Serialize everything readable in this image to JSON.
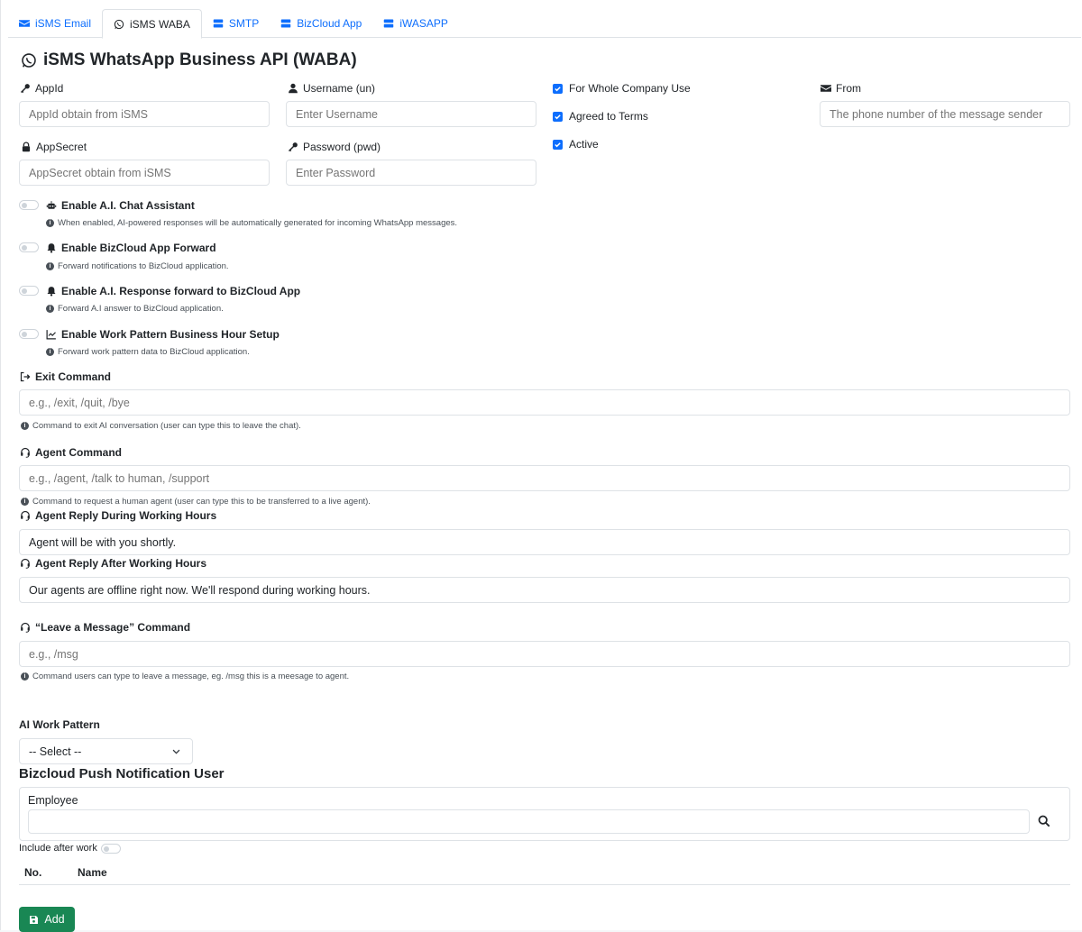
{
  "tabs": [
    {
      "label": "iSMS Email",
      "icon": "envelope-icon",
      "active": false
    },
    {
      "label": "iSMS WABA",
      "icon": "whatsapp-icon",
      "active": true
    },
    {
      "label": "SMTP",
      "icon": "server-icon",
      "active": false
    },
    {
      "label": "BizCloud App",
      "icon": "server-icon",
      "active": false
    },
    {
      "label": "iWASAPP",
      "icon": "server-icon",
      "active": false
    }
  ],
  "title": "iSMS WhatsApp Business API (WABA)",
  "fields": {
    "appid": {
      "label": "AppId",
      "placeholder": "AppId obtain from iSMS"
    },
    "username": {
      "label": "Username (un)",
      "placeholder": "Enter Username"
    },
    "appsecret": {
      "label": "AppSecret",
      "placeholder": "AppSecret obtain from iSMS"
    },
    "password": {
      "label": "Password (pwd)",
      "placeholder": "Enter Password"
    },
    "from": {
      "label": "From",
      "placeholder": "The phone number of the message sender"
    }
  },
  "checkboxes": {
    "whole_company": {
      "label": "For Whole Company Use",
      "checked": true
    },
    "agreed": {
      "label": "Agreed to Terms",
      "checked": true
    },
    "active": {
      "label": "Active",
      "checked": true
    }
  },
  "toggles": [
    {
      "label": "Enable A.I. Chat Assistant",
      "icon": "robot-icon",
      "help": "When enabled, AI-powered responses will be automatically generated for incoming WhatsApp messages.",
      "on": false
    },
    {
      "label": "Enable BizCloud App Forward",
      "icon": "bell-icon",
      "help": "Forward notifications to BizCloud application.",
      "on": false
    },
    {
      "label": "Enable A.I. Response forward to BizCloud App",
      "icon": "bell-icon",
      "help": "Forward A.I answer to BizCloud application.",
      "on": false
    },
    {
      "label": "Enable Work Pattern Business Hour Setup",
      "icon": "chart-line-icon",
      "help": "Forward work pattern data to BizCloud application.",
      "on": false
    }
  ],
  "exit_command": {
    "label": "Exit Command",
    "placeholder": "e.g., /exit, /quit, /bye",
    "help": "Command to exit AI conversation (user can type this to leave the chat)."
  },
  "agent_command": {
    "label": "Agent Command",
    "placeholder": "e.g., /agent, /talk to human, /support",
    "help": "Command to request a human agent (user can type this to be transferred to a live agent)."
  },
  "reply_during": {
    "label": "Agent Reply During Working Hours",
    "value": "Agent will be with you shortly."
  },
  "reply_after": {
    "label": "Agent Reply After Working Hours",
    "value": "Our agents are offline right now. We'll respond during working hours."
  },
  "leave_message": {
    "label": "“Leave a Message” Command",
    "placeholder": "e.g., /msg",
    "help": "Command users can type to leave a message, eg. /msg this is a meesage to agent."
  },
  "ai_work_pattern": {
    "label": "AI Work Pattern",
    "selected": "-- Select --"
  },
  "push_section": {
    "title": "Bizcloud Push Notification User",
    "employee_label": "Employee",
    "employee_value": "",
    "include_after_work": "Include after work",
    "col_no": "No.",
    "col_name": "Name"
  },
  "add_button": "Add",
  "colors": {
    "accent": "#0d6efd",
    "success": "#198754"
  }
}
